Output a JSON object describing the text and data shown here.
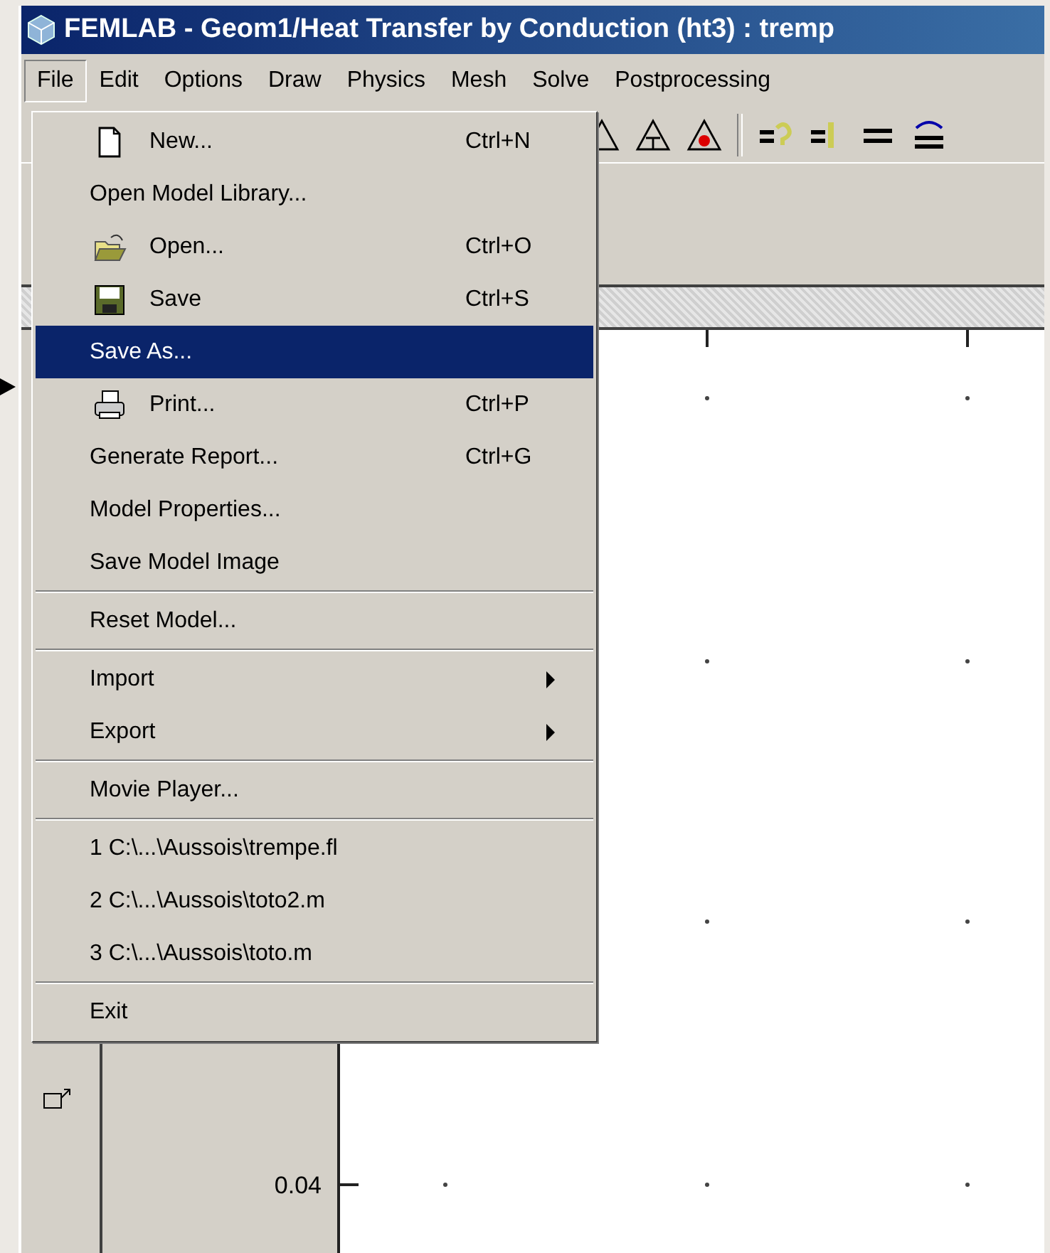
{
  "window": {
    "title": "FEMLAB - Geom1/Heat Transfer by Conduction (ht3) : tremp"
  },
  "menu_bar": [
    {
      "label": "File",
      "selected": true
    },
    {
      "label": "Edit",
      "selected": false
    },
    {
      "label": "Options",
      "selected": false
    },
    {
      "label": "Draw",
      "selected": false
    },
    {
      "label": "Physics",
      "selected": false
    },
    {
      "label": "Mesh",
      "selected": false
    },
    {
      "label": "Solve",
      "selected": false
    },
    {
      "label": "Postprocessing",
      "selected": false
    }
  ],
  "file_menu": {
    "groups": [
      [
        {
          "label": "New...",
          "shortcut": "Ctrl+N",
          "kind": "new",
          "selected": false
        },
        {
          "label": "Open Model Library...",
          "kind": "plain",
          "selected": false
        },
        {
          "label": "Open...",
          "shortcut": "Ctrl+O",
          "kind": "open",
          "selected": false
        },
        {
          "label": "Save",
          "shortcut": "Ctrl+S",
          "kind": "save",
          "selected": false
        },
        {
          "label": "Save As...",
          "kind": "plain",
          "selected": true
        },
        {
          "label": "Print...",
          "shortcut": "Ctrl+P",
          "kind": "print",
          "selected": false
        },
        {
          "label": "Generate Report...",
          "shortcut": "Ctrl+G",
          "kind": "plain",
          "selected": false
        },
        {
          "label": "Model Properties...",
          "kind": "plain",
          "selected": false
        },
        {
          "label": "Save Model Image",
          "kind": "plain",
          "selected": false
        }
      ],
      [
        {
          "label": "Reset Model...",
          "kind": "plain",
          "selected": false
        }
      ],
      [
        {
          "label": "Import",
          "kind": "submenu",
          "selected": false
        },
        {
          "label": "Export",
          "kind": "submenu",
          "selected": false
        }
      ],
      [
        {
          "label": "Movie Player...",
          "kind": "plain",
          "selected": false
        }
      ],
      [
        {
          "label": "1 C:\\...\\Aussois\\trempe.fl",
          "kind": "plain",
          "selected": false
        },
        {
          "label": "2 C:\\...\\Aussois\\toto2.m",
          "kind": "plain",
          "selected": false
        },
        {
          "label": "3 C:\\...\\Aussois\\toto.m",
          "kind": "plain",
          "selected": false
        }
      ],
      [
        {
          "label": "Exit",
          "kind": "plain",
          "selected": false
        }
      ]
    ]
  },
  "plot": {
    "y_tick_label": "0.04"
  }
}
